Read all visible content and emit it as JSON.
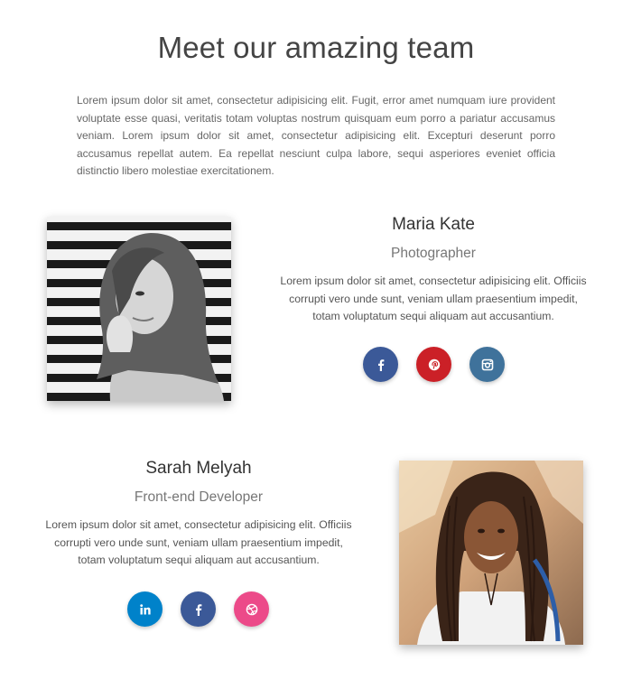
{
  "header": {
    "title": "Meet our amazing team"
  },
  "intro": {
    "text": "Lorem ipsum dolor sit amet, consectetur adipisicing elit. Fugit, error amet numquam iure provident voluptate esse quasi, veritatis totam voluptas nostrum quisquam eum porro a pariatur accusamus veniam. Lorem ipsum dolor sit amet, consectetur adipisicing elit. Excepturi deserunt porro accusamus repellat autem. Ea repellat nesciunt culpa labore, sequi asperiores eveniet officia distinctio libero molestiae exercitationem."
  },
  "members": [
    {
      "name": "Maria Kate",
      "role": "Photographer",
      "bio": "Lorem ipsum dolor sit amet, consectetur adipisicing elit. Officiis corrupti vero unde sunt, veniam ullam praesentium impedit, totam voluptatum sequi aliquam aut accusantium.",
      "socials": [
        {
          "icon": "facebook-icon",
          "glyph": "f",
          "color": "#3b5998"
        },
        {
          "icon": "pinterest-icon",
          "glyph": "p",
          "color": "#cb2027"
        },
        {
          "icon": "instagram-icon",
          "glyph": "ig",
          "color": "#3f729b"
        }
      ]
    },
    {
      "name": "Sarah Melyah",
      "role": "Front-end Developer",
      "bio": "Lorem ipsum dolor sit amet, consectetur adipisicing elit. Officiis corrupti vero unde sunt, veniam ullam praesentium impedit, totam voluptatum sequi aliquam aut accusantium.",
      "socials": [
        {
          "icon": "linkedin-icon",
          "glyph": "in",
          "color": "#0082ca"
        },
        {
          "icon": "facebook-icon",
          "glyph": "f",
          "color": "#3b5998"
        },
        {
          "icon": "dribbble-icon",
          "glyph": "dr",
          "color": "#ec4a89"
        }
      ]
    }
  ]
}
